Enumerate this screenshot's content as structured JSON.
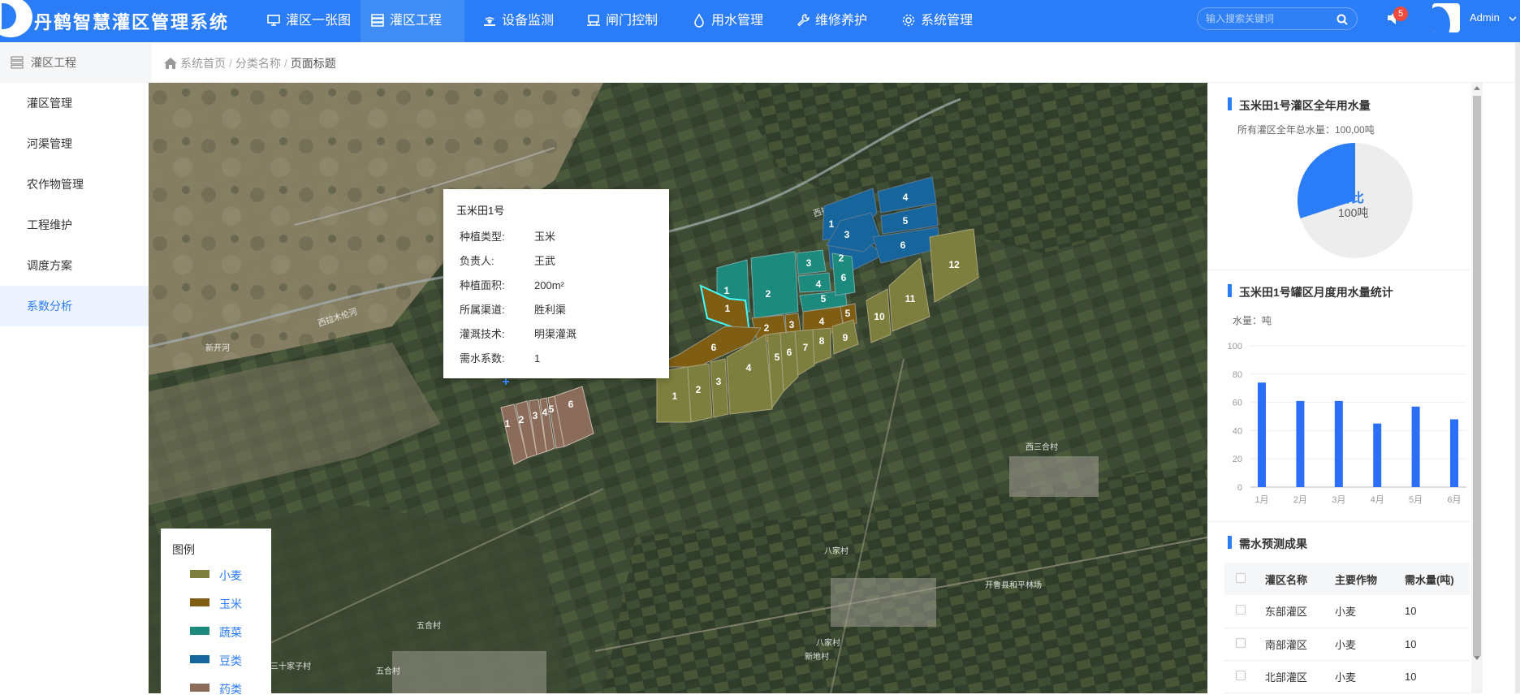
{
  "app": {
    "title": "丹鹤智慧灌区管理系统"
  },
  "nav": [
    {
      "label": "灌区一张图"
    },
    {
      "label": "灌区工程"
    },
    {
      "label": "设备监测"
    },
    {
      "label": "闸门控制"
    },
    {
      "label": "用水管理"
    },
    {
      "label": "维修养护"
    },
    {
      "label": "系统管理"
    }
  ],
  "search": {
    "placeholder": "输入搜索关键词"
  },
  "notifications": {
    "count": "5"
  },
  "user": {
    "name": "Admin"
  },
  "sidebar": {
    "header": "灌区工程",
    "items": [
      {
        "label": "灌区管理"
      },
      {
        "label": "河渠管理"
      },
      {
        "label": "农作物管理"
      },
      {
        "label": "工程维护"
      },
      {
        "label": "调度方案"
      },
      {
        "label": "系数分析"
      }
    ]
  },
  "breadcrumb": {
    "home": "系统首页",
    "category": "分类名称",
    "current": "页面标题"
  },
  "map": {
    "river_labels": [
      "西拉木伦河",
      "西拉木伦河",
      "新开河"
    ],
    "village_labels": [
      "西三合村",
      "八家村",
      "八家村",
      "新地村",
      "五合村",
      "五合村",
      "三十家子村",
      "开鲁县和平林场"
    ],
    "field_numbers": {
      "beans": [
        "1",
        "2",
        "3",
        "4",
        "5",
        "6"
      ],
      "veg": [
        "1",
        "2",
        "3",
        "4",
        "5",
        "6"
      ],
      "corn": [
        "1",
        "2",
        "3",
        "4",
        "5",
        "6"
      ],
      "wheat": [
        "1",
        "2",
        "3",
        "4",
        "5",
        "6",
        "7",
        "8",
        "9",
        "10",
        "11",
        "12"
      ],
      "herb": [
        "1",
        "2",
        "3",
        "4",
        "5",
        "6"
      ]
    }
  },
  "popup": {
    "title": "玉米田1号",
    "rows": [
      {
        "k": "种植类型:",
        "v": "玉米"
      },
      {
        "k": "负责人:",
        "v": "王武"
      },
      {
        "k": "种植面积:",
        "v": "200m²"
      },
      {
        "k": "所属渠道:",
        "v": "胜利渠"
      },
      {
        "k": "灌溉技术:",
        "v": "明渠灌溉"
      },
      {
        "k": "需水系数:",
        "v": "1"
      }
    ]
  },
  "legend": {
    "title": "图例",
    "items": [
      {
        "label": "小麦",
        "color": "#7d7f3f"
      },
      {
        "label": "玉米",
        "color": "#7f5d12"
      },
      {
        "label": "蔬菜",
        "color": "#1c8a7c"
      },
      {
        "label": "豆类",
        "color": "#16659c"
      },
      {
        "label": "药类",
        "color": "#8b6b5a"
      }
    ]
  },
  "panel_pie": {
    "title": "玉米田1号灌区全年用水量",
    "note": "所有灌区全年总水量：100,00吨",
    "percent_label": "30%占比",
    "amount_label": "100吨",
    "share": 0.3,
    "colors": {
      "share": "#2b7df7",
      "rest": "#ededed"
    }
  },
  "panel_bar": {
    "title": "玉米田1号罐区月度用水量统计",
    "unit": "水量：吨"
  },
  "chart_data": {
    "type": "bar",
    "categories": [
      "1月",
      "2月",
      "3月",
      "4月",
      "5月",
      "6月"
    ],
    "values": [
      74,
      61,
      61,
      45,
      57,
      48
    ],
    "ylim": [
      0,
      100
    ],
    "yticks": [
      "0",
      "20",
      "40",
      "60",
      "80",
      "100"
    ],
    "grid": true,
    "color": "#2b6ef7"
  },
  "panel_table": {
    "title": "需水预测成果",
    "headers": [
      "灌区名称",
      "主要作物",
      "需水量(吨)"
    ],
    "rows": [
      [
        "东部灌区",
        "小麦",
        "10"
      ],
      [
        "南部灌区",
        "小麦",
        "10"
      ],
      [
        "北部灌区",
        "小麦",
        "10"
      ]
    ]
  }
}
